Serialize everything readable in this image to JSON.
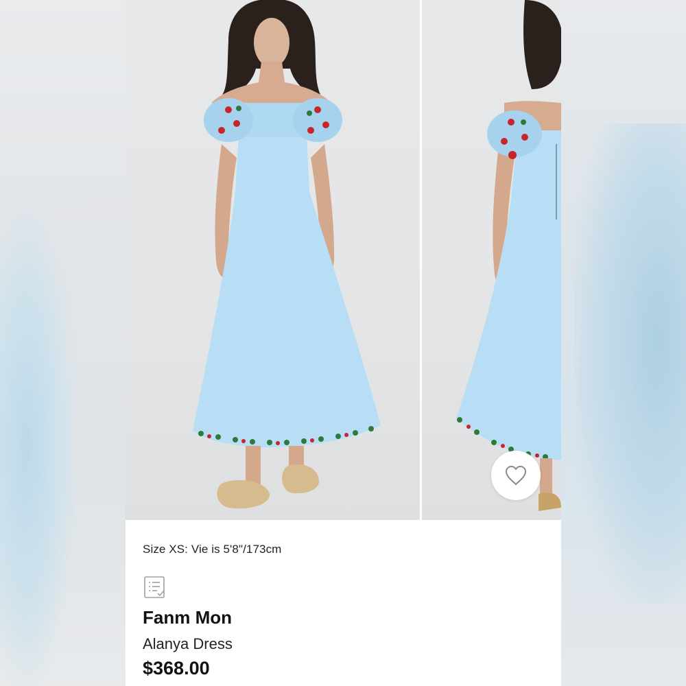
{
  "gallery": {
    "images": [
      {
        "alt": "Front view of light blue off-shoulder dress"
      },
      {
        "alt": "Side view of light blue off-shoulder dress"
      }
    ]
  },
  "favorite": {
    "icon": "heart-outline-icon"
  },
  "product": {
    "size_note": "Size XS: Vie is 5'8\"/173cm",
    "brand": "Fanm Mon",
    "name": "Alanya Dress",
    "price": "$368.00"
  },
  "colors": {
    "dress": "#b5dcf3",
    "background": "#e6e7e9",
    "text": "#111111"
  }
}
